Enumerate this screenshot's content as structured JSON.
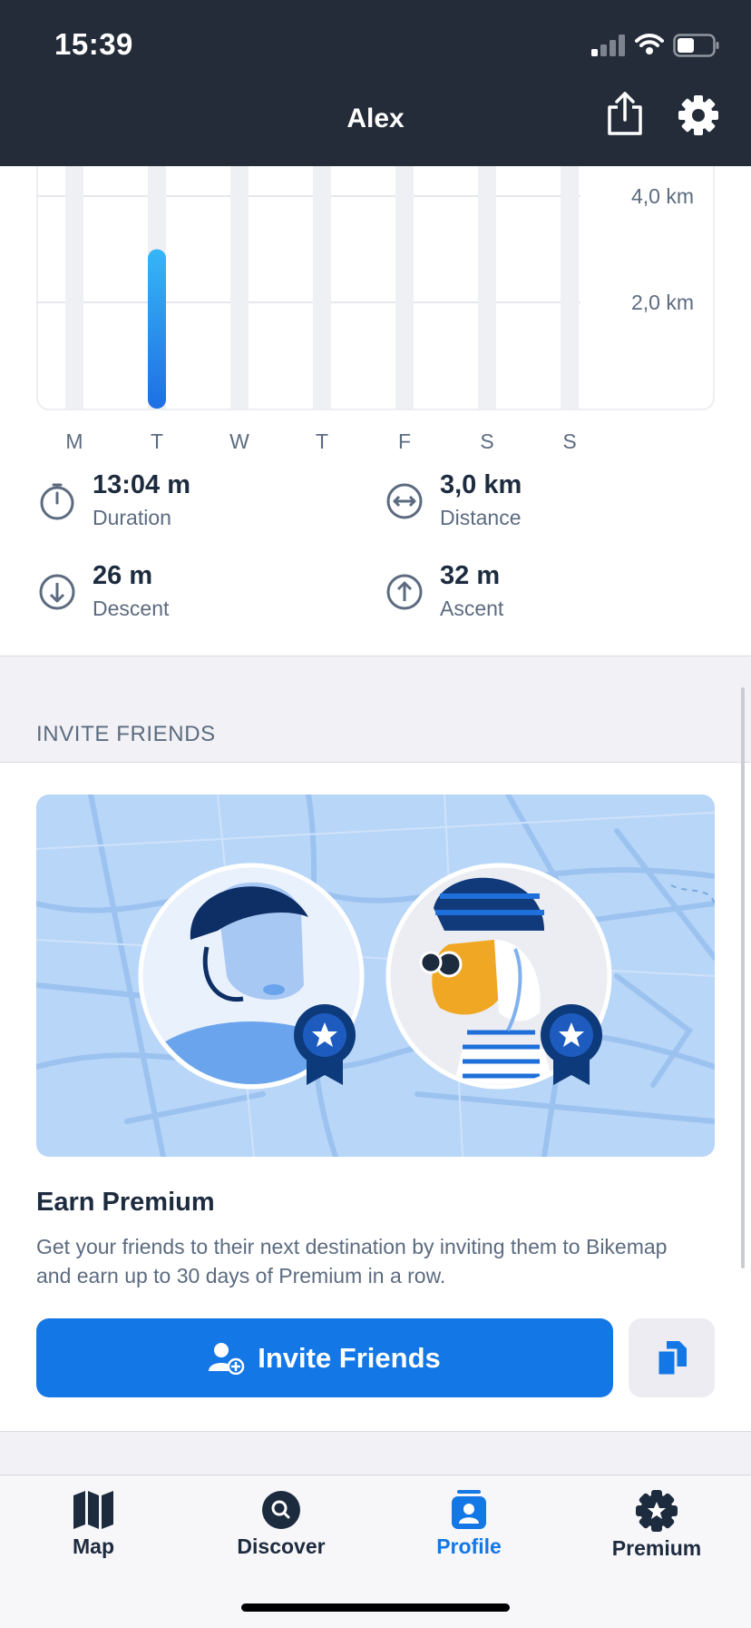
{
  "status": {
    "time": "15:39"
  },
  "header": {
    "title": "Alex"
  },
  "chart_data": {
    "type": "bar",
    "categories": [
      "M",
      "T",
      "W",
      "T",
      "F",
      "S",
      "S"
    ],
    "values": [
      0,
      3.0,
      0,
      0,
      0,
      0,
      0
    ],
    "unit": "km",
    "yticks": [
      "2,0 km",
      "4,0 km"
    ],
    "ylim": [
      0,
      4.2
    ],
    "colors": {
      "bar": "#1f6fe3",
      "track": "#eff0f4"
    }
  },
  "stats": {
    "duration": {
      "value": "13:04 m",
      "label": "Duration",
      "icon": "stopwatch-icon"
    },
    "distance": {
      "value": "3,0 km",
      "label": "Distance",
      "icon": "distance-icon"
    },
    "descent": {
      "value": "26 m",
      "label": "Descent",
      "icon": "arrow-down-icon"
    },
    "ascent": {
      "value": "32 m",
      "label": "Ascent",
      "icon": "arrow-up-icon"
    }
  },
  "invite": {
    "section_title": "INVITE FRIENDS",
    "earn_title": "Earn Premium",
    "earn_text": "Get your friends to their next destination by inviting them to Bikemap and earn up to 30 days of Premium in a row.",
    "button_label": "Invite Friends"
  },
  "tabs": [
    {
      "label": "Map",
      "icon": "map-icon"
    },
    {
      "label": "Discover",
      "icon": "search-icon"
    },
    {
      "label": "Profile",
      "icon": "profile-icon",
      "active": true
    },
    {
      "label": "Premium",
      "icon": "premium-badge-icon"
    }
  ],
  "colors": {
    "accent": "#1477e6",
    "header": "#232c38"
  }
}
